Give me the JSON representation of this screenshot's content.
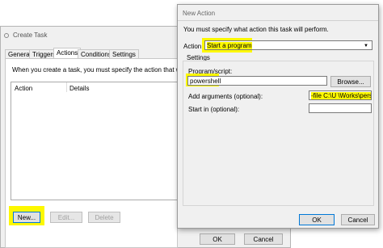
{
  "create_task": {
    "title": "Create Task",
    "tabs": [
      "General",
      "Triggers",
      "Actions",
      "Conditions",
      "Settings"
    ],
    "intro": "When you create a task, you must specify the action that will occur w",
    "columns": [
      "Action",
      "Details"
    ],
    "buttons": {
      "new": "New...",
      "edit": "Edit...",
      "delete": "Delete"
    },
    "footer": {
      "ok": "OK",
      "cancel": "Cancel"
    }
  },
  "new_action": {
    "title": "New Action",
    "intro": "You must specify what action this task will perform.",
    "action_label": "Action:",
    "action_value": "Start a program",
    "settings_label": "Settings",
    "program_label": "Program/script:",
    "program_value": "powershell",
    "browse": "Browse...",
    "arguments_label": "Add arguments (optional):",
    "arguments_value": "-file C:\\U  \\Works\\person",
    "start_in_label": "Start in (optional):",
    "start_in_value": "",
    "ok": "OK",
    "cancel": "Cancel"
  },
  "colors": {
    "highlight": "#fdf800",
    "focus_border": "#0078d7"
  }
}
